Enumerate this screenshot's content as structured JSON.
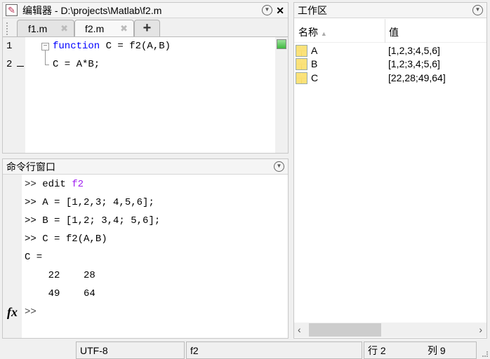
{
  "editor": {
    "title": "编辑器 - D:\\projects\\Matlab\\f2.m",
    "tabs": [
      {
        "label": "f1.m"
      },
      {
        "label": "f2.m",
        "active": true
      }
    ],
    "add_tab": "+",
    "close": "✕",
    "lines": [
      {
        "num": "1",
        "keyword": "function",
        "rest": " C = f2(A,B)"
      },
      {
        "num": "2",
        "keyword": "",
        "rest": "C = A*B;"
      }
    ]
  },
  "command": {
    "title": "命令行窗口",
    "prompt": ">>",
    "lines": [
      {
        "prompt": ">>",
        "text": " edit ",
        "arg": "f2"
      },
      {
        "prompt": ">>",
        "text": " A = [1,2,3; 4,5,6];",
        "arg": ""
      },
      {
        "prompt": ">>",
        "text": " B = [1,2; 3,4; 5,6];",
        "arg": ""
      },
      {
        "prompt": ">>",
        "text": " C = f2(A,B)",
        "arg": ""
      },
      {
        "prompt": "",
        "text": "C =",
        "arg": ""
      },
      {
        "prompt": "",
        "text": "",
        "arg": ""
      },
      {
        "prompt": "",
        "text": "    22    28",
        "arg": ""
      },
      {
        "prompt": "",
        "text": "    49    64",
        "arg": ""
      }
    ],
    "fx": "fx"
  },
  "workspace": {
    "title": "工作区",
    "col_name": "名称",
    "col_value": "值",
    "vars": [
      {
        "name": "A",
        "value": "[1,2,3;4,5,6]"
      },
      {
        "name": "B",
        "value": "[1,2;3,4;5,6]"
      },
      {
        "name": "C",
        "value": "[22,28;49,64]"
      }
    ]
  },
  "status": {
    "encoding": "UTF-8",
    "function": "f2",
    "row_label": "行",
    "row": "2",
    "col_label": "列",
    "col": "9"
  },
  "colors": {
    "keyword": "#0000ff",
    "string": "#a020f0"
  }
}
